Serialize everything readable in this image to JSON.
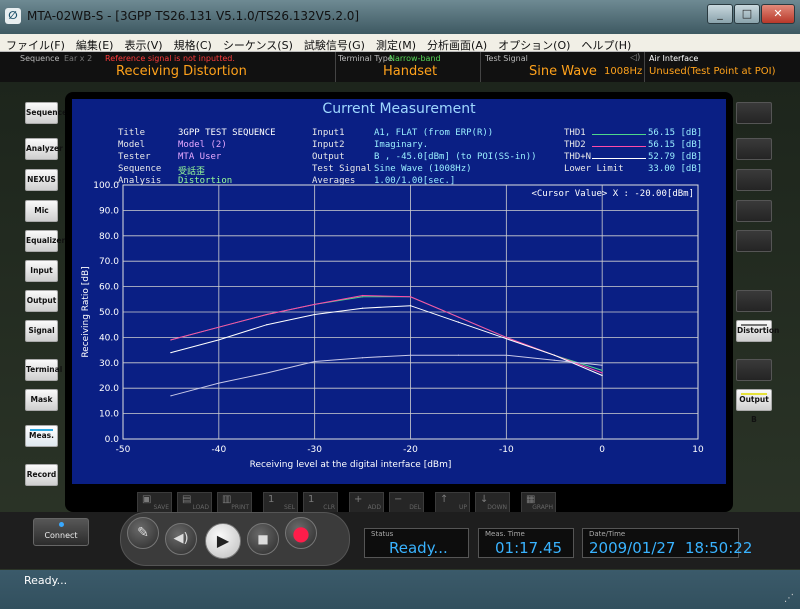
{
  "window": {
    "title": "MTA-02WB-S - [3GPP TS26.131 V5.1.0/TS26.132V5.2.0]",
    "icon": "app-icon",
    "controls": [
      "_",
      "□",
      "✕"
    ]
  },
  "menu": [
    "ファイル(F)",
    "編集(E)",
    "表示(V)",
    "規格(C)",
    "シーケンス(S)",
    "試験信号(G)",
    "測定(M)",
    "分析画面(A)",
    "オプション(O)",
    "ヘルプ(H)"
  ],
  "header": {
    "sequence_label": "Sequence",
    "ear_label": "Ear x 2",
    "warning": "Reference signal is not inputted.",
    "sequence_value": "Receiving Distortion",
    "terminal_label": "Terminal Type",
    "terminal_band": "Narrow-band",
    "terminal_value": "Handset",
    "signal_label": "Test Signal",
    "signal_value": "Sine Wave",
    "signal_freq": "1008Hz",
    "air_label": "Air Interface",
    "air_value": "Unused(Test Point at POI)"
  },
  "left_buttons": [
    "Sequence",
    "Analyzer",
    "NEXUS",
    "Mic",
    "Equalizer",
    "Input",
    "Output",
    "Signal",
    "Terminal",
    "Mask",
    "Meas.",
    "Record"
  ],
  "right_buttons": {
    "distortion": "Distortion",
    "output_b": "Output B"
  },
  "screen": {
    "title": "Current Measurement",
    "info": {
      "title_label": "Title",
      "title_value": "3GPP TEST SEQUENCE",
      "model_label": "Model",
      "model_value": "Model (2)",
      "tester_label": "Tester",
      "tester_value": "MTA User",
      "sequence_label": "Sequence",
      "sequence_value": "受話歪",
      "analysis_label": "Analysis",
      "analysis_value": "Distortion",
      "input1_label": "Input1",
      "input1_value": "A1, FLAT (from ERP(R))",
      "input2_label": "Input2",
      "input2_value": "Imaginary.",
      "output_label": "Output",
      "output_value": "B , -45.0[dBm] (to POI(SS-in))",
      "signal_label": "Test Signal",
      "signal_value": "Sine Wave (1008Hz)",
      "averages_label": "Averages",
      "averages_value": "1.00/1.00[sec.]"
    },
    "legend": {
      "thd1_label": "THD1",
      "thd1_value": "56.15 [dB]",
      "thd2_label": "THD2",
      "thd2_value": "56.15 [dB]",
      "thdn_label": "THD+N",
      "thdn_value": "52.79 [dB]",
      "lower_label": "Lower Limit",
      "lower_value": "33.00 [dB]"
    },
    "cursor": "<Cursor Value> X : -20.00[dBm]"
  },
  "chart_data": {
    "type": "line",
    "xlabel": "Receiving level at the digital interface [dBm]",
    "ylabel": "Receiving Ratio [dB]",
    "xlim": [
      -50,
      10
    ],
    "ylim": [
      0,
      100
    ],
    "xticks": [
      "-50",
      "-40",
      "-30",
      "-20",
      "-10",
      "0",
      "10"
    ],
    "yticks": [
      "0.0",
      "10.0",
      "20.0",
      "30.0",
      "40.0",
      "50.0",
      "60.0",
      "70.0",
      "80.0",
      "90.0",
      "100.0"
    ],
    "grid": true,
    "series": [
      {
        "name": "THD1",
        "color": "#4fd68a",
        "x": [
          -45,
          -40,
          -35,
          -30,
          -25,
          -20,
          -15,
          -10,
          -5,
          0
        ],
        "y": [
          39,
          44,
          49,
          53,
          56,
          56,
          48,
          40,
          33,
          27
        ]
      },
      {
        "name": "THD2",
        "color": "#ff4aa8",
        "x": [
          -45,
          -40,
          -35,
          -30,
          -25,
          -20,
          -15,
          -10,
          -5,
          0
        ],
        "y": [
          39,
          44,
          49,
          53,
          56.5,
          56,
          48,
          40,
          33,
          26
        ]
      },
      {
        "name": "THD+N",
        "color": "#ffffff",
        "x": [
          -45,
          -40,
          -35,
          -30,
          -25,
          -20,
          -15,
          -10,
          -5,
          0
        ],
        "y": [
          34,
          39,
          45,
          49,
          51.5,
          52.5,
          46,
          39.5,
          33,
          25
        ]
      },
      {
        "name": "Lower Limit",
        "color": "#c8c8e8",
        "x": [
          -45,
          -40,
          -35,
          -30,
          -25,
          -20,
          -15,
          -10,
          -5,
          0
        ],
        "y": [
          17,
          22,
          26,
          30.5,
          32,
          33,
          33,
          33,
          31,
          29
        ]
      }
    ]
  },
  "toolbar": [
    "SAVE",
    "LOAD",
    "PRINT",
    "SEL",
    "CLR",
    "ADD",
    "DEL",
    "UP",
    "DOWN",
    "GRAPH"
  ],
  "connect_label": "Connect",
  "status_panels": {
    "status_label": "Status",
    "status_value": "Ready...",
    "meas_label": "Meas. Time",
    "meas_value": "01:17.45",
    "date_label": "Date/Time",
    "date_value": "2009/01/27  18:50:22"
  },
  "statusbar_text": "Ready..."
}
